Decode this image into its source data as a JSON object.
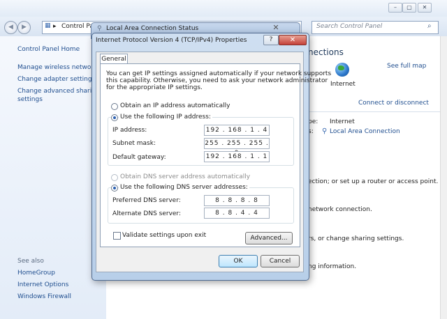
{
  "control_panel": {
    "address": "Control Panel",
    "search_placeholder": "Search Control Panel",
    "left_links": [
      "Control Panel Home",
      "Manage wireless networks",
      "Change adapter settings",
      "Change advanced sharing",
      "settings"
    ],
    "see_also": {
      "heading": "See also",
      "items": [
        "HomeGroup",
        "Internet Options",
        "Windows Firewall"
      ]
    },
    "content": {
      "heading_fragment": "nections",
      "see_full_map": "See full map",
      "internet_label": "Internet",
      "connect_disconnect": "Connect or disconnect",
      "type_label": "pe:",
      "type_value": "Internet",
      "connections_label": "s:",
      "connections_value": "Local Area Connection",
      "fragments": [
        "ection; or set up a router or access point.",
        "network connection.",
        "rs, or change sharing settings.",
        "ng information."
      ]
    }
  },
  "lac_window": {
    "title": "Local Area Connection Status"
  },
  "dialog": {
    "title": "Internet Protocol Version 4 (TCP/IPv4) Properties",
    "help_label": "?",
    "close_label": "✕",
    "tab_general": "General",
    "intro": [
      "You can get IP settings assigned automatically if your network supports",
      "this capability. Otherwise, you need to ask your network administrator",
      "for the appropriate IP settings."
    ],
    "ip_auto": "Obtain an IP address automatically",
    "ip_manual": "Use the following IP address:",
    "ip_address_label": "IP address:",
    "ip_address": "192 . 168 . 1 . 4",
    "subnet_label": "Subnet mask:",
    "subnet": "255 . 255 . 255 . 0",
    "gateway_label": "Default gateway:",
    "gateway": "192 . 168 . 1 . 1",
    "dns_auto": "Obtain DNS server address automatically",
    "dns_manual": "Use the following DNS server addresses:",
    "preferred_label": "Preferred DNS server:",
    "preferred": "8 . 8 . 8 . 8",
    "alternate_label": "Alternate DNS server:",
    "alternate": "8 . 8 . 4 . 4",
    "validate_label": "Validate settings upon exit",
    "advanced_label": "Advanced...",
    "ok_label": "OK",
    "cancel_label": "Cancel"
  }
}
